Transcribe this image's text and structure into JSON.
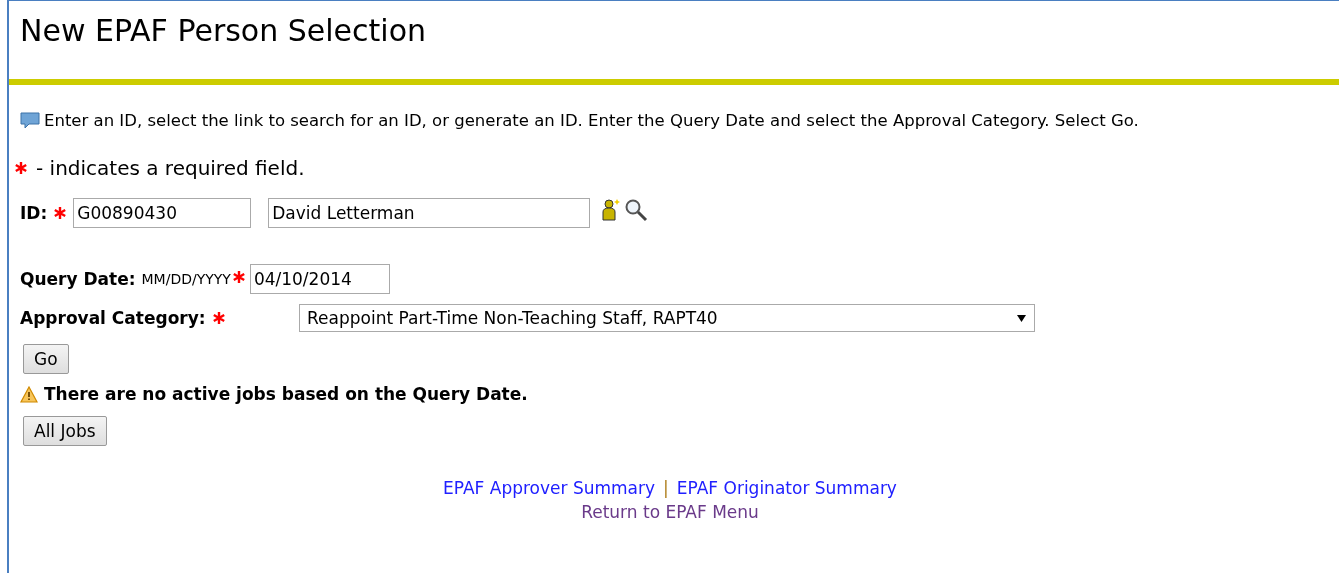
{
  "title": "New EPAF Person Selection",
  "info": "Enter an ID, select the link to search for an ID, or generate an ID. Enter the Query Date and select the Approval Category. Select Go.",
  "required_note": "- indicates a required field.",
  "id_field": {
    "label": "ID:",
    "value": "G00890430",
    "name_value": "David Letterman"
  },
  "query_date": {
    "label": "Query Date:",
    "format": "MM/DD/YYYY",
    "value": "04/10/2014"
  },
  "approval_category": {
    "label": "Approval Category:",
    "value": "Reappoint Part-Time Non-Teaching Staff, RAPT40"
  },
  "go_button": "Go",
  "warning": "There are no active jobs based on the Query Date.",
  "all_jobs_button": "All Jobs",
  "links": [
    "EPAF Approver Summary",
    "EPAF Originator Summary"
  ],
  "link_separator": "|",
  "return_link": "Return to EPAF Menu"
}
